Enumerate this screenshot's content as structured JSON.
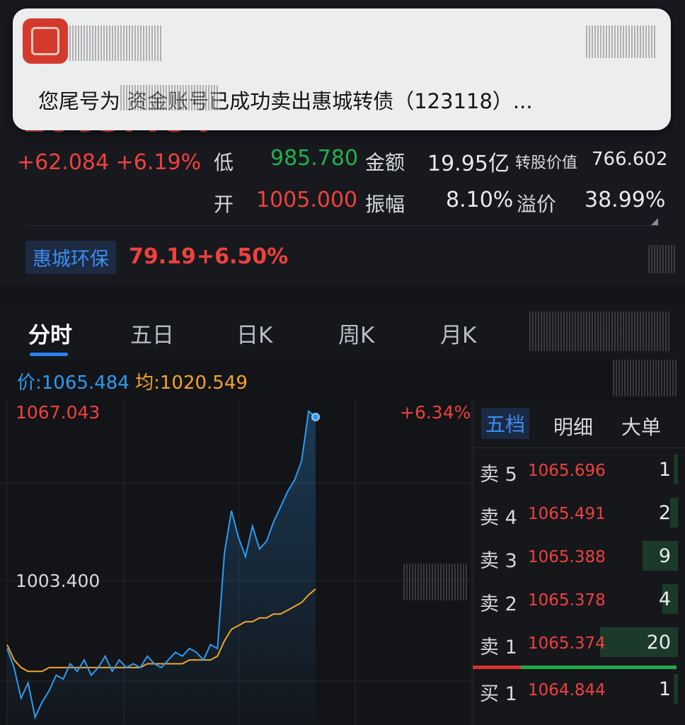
{
  "notification": {
    "text": "您尾号为 资金账号已成功卖出惠城转债（123118）..."
  },
  "quote": {
    "price": "1065.484",
    "change": "+62.084",
    "change_pct": "+6.19%",
    "low_label": "低",
    "low": "985.780",
    "amount_label": "金额",
    "amount": "19.95亿",
    "conv_value_label": "转股价值",
    "conv_value": "766.602",
    "open_label": "开",
    "open": "1005.000",
    "amplitude_label": "振幅",
    "amplitude": "8.10%",
    "premium_label": "溢价",
    "premium": "38.99%"
  },
  "underlying": {
    "name": "惠城环保",
    "price": "79.19",
    "change_pct": "+6.50%"
  },
  "tabs": [
    "分时",
    "五日",
    "日K",
    "周K",
    "月K"
  ],
  "chart_info": {
    "price_label": "价:",
    "price_value": "1065.484",
    "avg_label": "均:",
    "avg_value": "1020.549",
    "high": "1067.043",
    "base": "1003.400",
    "pct": "+6.34%"
  },
  "chart_data": {
    "type": "line",
    "series": [
      {
        "values": [
          1005,
          1000,
          992,
          996,
          987,
          991,
          994,
          998,
          997,
          1001,
          999,
          1002,
          998,
          1000,
          1003,
          999,
          1002,
          1000,
          1001,
          1000,
          1003,
          1001,
          1000,
          1002,
          1004,
          1003,
          1005,
          1004,
          1002,
          1006,
          1005,
          1030,
          1041,
          1034,
          1029,
          1037,
          1031,
          1033,
          1038,
          1042,
          1046,
          1049,
          1054,
          1067,
          1065.484
        ]
      },
      {
        "values": [
          1006,
          1002,
          1000,
          999,
          999,
          999,
          1000,
          1000,
          1000,
          1000,
          1000,
          1000,
          1000,
          1000,
          1000,
          1000,
          1000,
          1000,
          1000,
          1000,
          1001,
          1001,
          1001,
          1001,
          1001,
          1001,
          1002,
          1002,
          1002,
          1002,
          1003,
          1007,
          1010,
          1011,
          1012,
          1012,
          1013,
          1013,
          1014,
          1014,
          1015,
          1016,
          1017,
          1019,
          1020.549
        ]
      }
    ],
    "ylim": [
      985,
      1069
    ],
    "colors": {
      "price": "#2e9bf0",
      "average": "#f3a42a"
    }
  },
  "order_book": {
    "tabs": [
      "五档",
      "明细",
      "大单"
    ],
    "rows": [
      {
        "label": "卖 5",
        "price": "1065.696",
        "vol": "1",
        "vol_num": 1
      },
      {
        "label": "卖 4",
        "price": "1065.491",
        "vol": "2",
        "vol_num": 2
      },
      {
        "label": "卖 3",
        "price": "1065.388",
        "vol": "9",
        "vol_num": 9
      },
      {
        "label": "卖 2",
        "price": "1065.378",
        "vol": "4",
        "vol_num": 4
      },
      {
        "label": "卖 1",
        "price": "1065.374",
        "vol": "20",
        "vol_num": 20
      },
      {
        "label": "买 1",
        "price": "1064.844",
        "vol": "1",
        "vol_num": 1
      }
    ]
  }
}
